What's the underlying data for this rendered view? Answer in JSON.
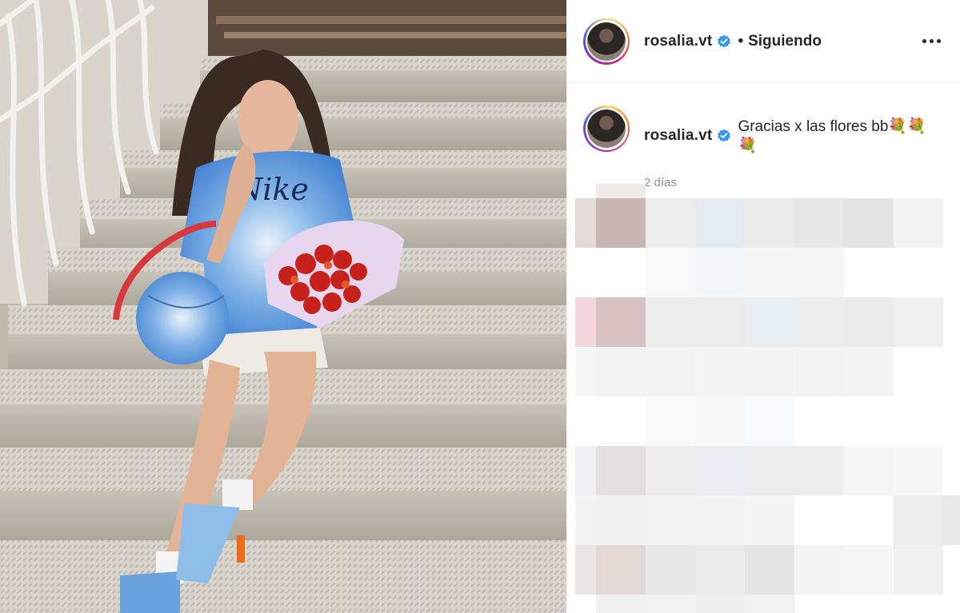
{
  "post": {
    "username": "rosalia.vt",
    "follow_separator": "•",
    "follow_status": "Siguiendo",
    "caption_username": "rosalia.vt",
    "caption_text": "Gracias x las flores bb💐💐💐",
    "timestamp": "2 días"
  },
  "icons": {
    "verified": "verified-badge-icon",
    "more": "more-options-icon"
  },
  "colors": {
    "verified_blue": "#3897f0",
    "text": "#262626",
    "muted": "#8e8e8e"
  }
}
